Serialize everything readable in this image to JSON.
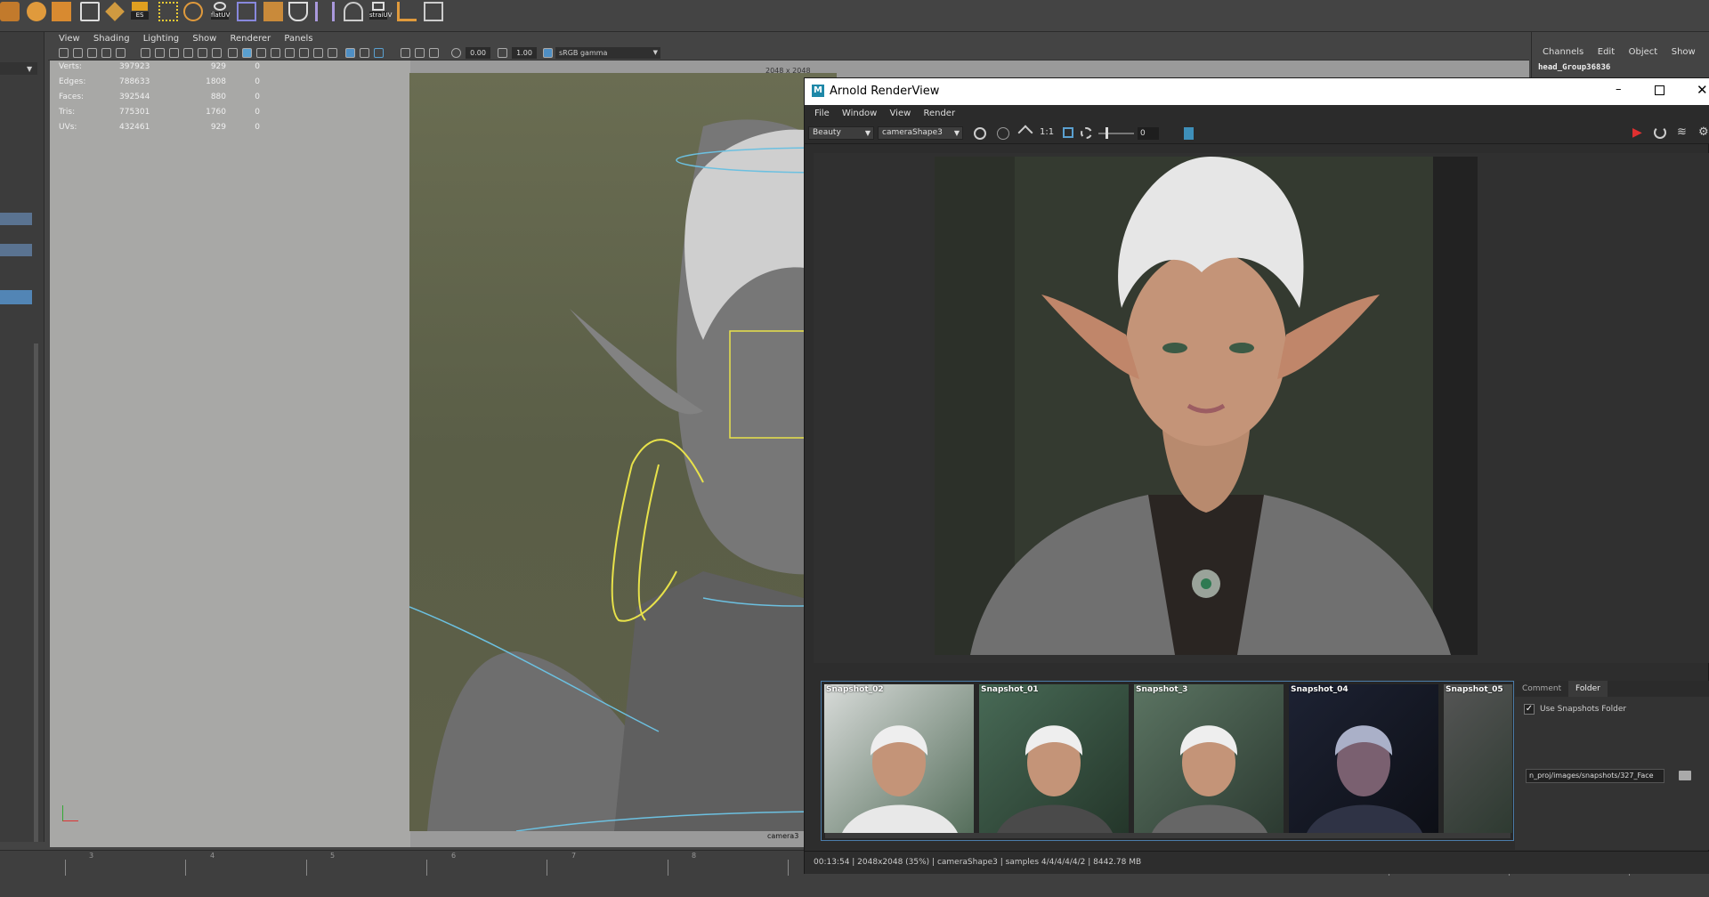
{
  "shelf": {
    "labels": [
      "ES",
      "flatUV",
      "straiUV"
    ]
  },
  "viewport": {
    "menu": [
      "View",
      "Shading",
      "Lighting",
      "Show",
      "Renderer",
      "Panels"
    ],
    "exposure": "0.00",
    "gamma": "1.00",
    "color_space": "sRGB gamma",
    "resolution_label": "2048 x 2048",
    "camera_label": "camera3",
    "hud": [
      {
        "label": "Verts:",
        "total": "397923",
        "selected": "929",
        "comp": "0"
      },
      {
        "label": "Edges:",
        "total": "788633",
        "selected": "1808",
        "comp": "0"
      },
      {
        "label": "Faces:",
        "total": "392544",
        "selected": "880",
        "comp": "0"
      },
      {
        "label": "Tris:",
        "total": "775301",
        "selected": "1760",
        "comp": "0"
      },
      {
        "label": "UVs:",
        "total": "432461",
        "selected": "929",
        "comp": "0"
      }
    ]
  },
  "channel_box": {
    "menu": [
      "Channels",
      "Edit",
      "Object",
      "Show"
    ],
    "object_name": "head_Group36836"
  },
  "timeline": {
    "frames": [
      "3",
      "4",
      "5",
      "6",
      "7",
      "8"
    ]
  },
  "arnold": {
    "title": "Arnold RenderView",
    "app_icon": "M",
    "menu": [
      "File",
      "Window",
      "View",
      "Render"
    ],
    "aov": "Beauty",
    "camera": "cameraShape3",
    "ratio": "1:1",
    "exposure_value": "0",
    "snapshots": [
      "Snapshot_02",
      "Snapshot_01",
      "Snapshot_3",
      "Snapshot_04",
      "Snapshot_05"
    ],
    "tabs": [
      "Comment",
      "Folder"
    ],
    "use_snapshots_folder": "Use Snapshots Folder",
    "folder_path": "n_proj/images/snapshots/327_Face",
    "status": "00:13:54 | 2048x2048 (35%) | cameraShape3  | samples 4/4/4/4/4/2 | 8442.78 MB"
  },
  "colors": {
    "accent": "#4c7daa",
    "render_red": "#e03030",
    "selection_yellow": "#e8e24a",
    "curve_cyan": "#6cc0e0"
  }
}
